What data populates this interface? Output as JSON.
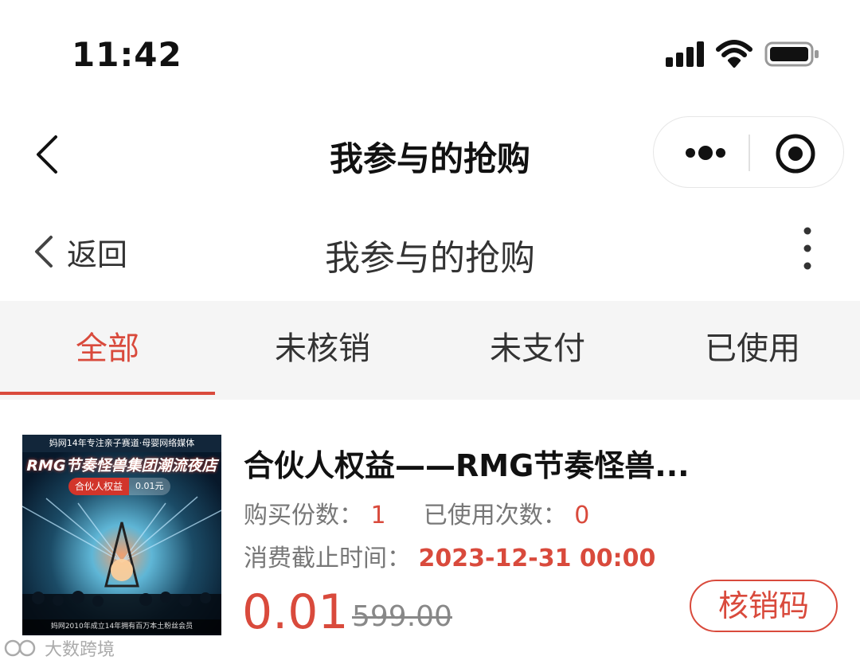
{
  "status_bar": {
    "time": "11:42"
  },
  "mp_header": {
    "title": "我参与的抢购"
  },
  "page_nav": {
    "back_label": "返回",
    "title": "我参与的抢购"
  },
  "tabs": [
    {
      "label": "全部",
      "active": true
    },
    {
      "label": "未核销",
      "active": false
    },
    {
      "label": "未支付",
      "active": false
    },
    {
      "label": "已使用",
      "active": false
    }
  ],
  "order": {
    "title": "合伙人权益——RMG节奏怪兽...",
    "purchase_count_label": "购买份数：",
    "purchase_count": "1",
    "used_count_label": "已使用次数：",
    "used_count": "0",
    "deadline_label": "消费截止时间：",
    "deadline": "2023-12-31 00:00",
    "price": "0.01",
    "original_price": "599.00",
    "verify_button": "核销码",
    "thumbnail": {
      "header": "妈网14年专注亲子赛道·母婴网络媒体",
      "brand": "RMG节奏怪兽集团潮流夜店",
      "tag": "合伙人权益",
      "tag_price": "0.01元",
      "footer": "妈网2010年成立14年拥有百万本土粉丝会员"
    }
  },
  "watermark": {
    "text": "大数跨境"
  },
  "colors": {
    "accent": "#d94a3c",
    "tab_bg": "#f5f5f5"
  }
}
